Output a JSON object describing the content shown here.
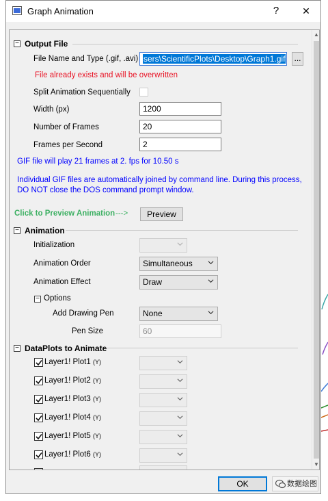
{
  "dialog": {
    "title": "Graph Animation",
    "help_glyph": "?",
    "close_glyph": "✕"
  },
  "output_file": {
    "header": "Output File",
    "file_label": "File Name and Type (.gif, .avi)",
    "file_value": "sers\\ScientificPlots\\Desktop\\Graph1.gif",
    "browse_label": "...",
    "warning": "File already exists and will be overwritten",
    "split_label": "Split Animation Sequentially",
    "width_label": "Width (px)",
    "width_value": "1200",
    "frames_label": "Number of Frames",
    "frames_value": "20",
    "fps_label": "Frames per Second",
    "fps_value": "2",
    "gif_info": "GIF file will play 21 frames at 2. fps for 10.50 s",
    "join_info": "Individual GIF files are automatically joined by command line. During this process, DO NOT close the DOS command prompt window.",
    "preview_hint": "Click to Preview Animation",
    "preview_arrow": "--->",
    "preview_button": "Preview"
  },
  "animation": {
    "header": "Animation",
    "init_label": "Initialization",
    "init_value": "",
    "order_label": "Animation Order",
    "order_value": "Simultaneous",
    "effect_label": "Animation Effect",
    "effect_value": "Draw",
    "options_header": "Options",
    "pen_label": "Add Drawing Pen",
    "pen_value": "None",
    "pen_size_label": "Pen Size",
    "pen_size_value": "60"
  },
  "dataplots": {
    "header": "DataPlots to Animate",
    "items": [
      {
        "name": "Layer1! Plot1",
        "suffix": "(Y)",
        "checked": true
      },
      {
        "name": "Layer1! Plot2",
        "suffix": "(Y)",
        "checked": true
      },
      {
        "name": "Layer1! Plot3",
        "suffix": "(Y)",
        "checked": true
      },
      {
        "name": "Layer1! Plot4",
        "suffix": "(Y)",
        "checked": true
      },
      {
        "name": "Layer1! Plot5",
        "suffix": "(Y)",
        "checked": true
      },
      {
        "name": "Layer1! Plot6",
        "suffix": "(Y)",
        "checked": true
      }
    ]
  },
  "footer": {
    "ok_label": "OK",
    "watermark": "数据绘图"
  },
  "icons": [
    "app-icon",
    "help-icon",
    "close-icon",
    "collapse-icon",
    "chevron-down-icon",
    "checkmark-icon",
    "scroll-up-icon",
    "scroll-down-icon",
    "wechat-icon"
  ]
}
